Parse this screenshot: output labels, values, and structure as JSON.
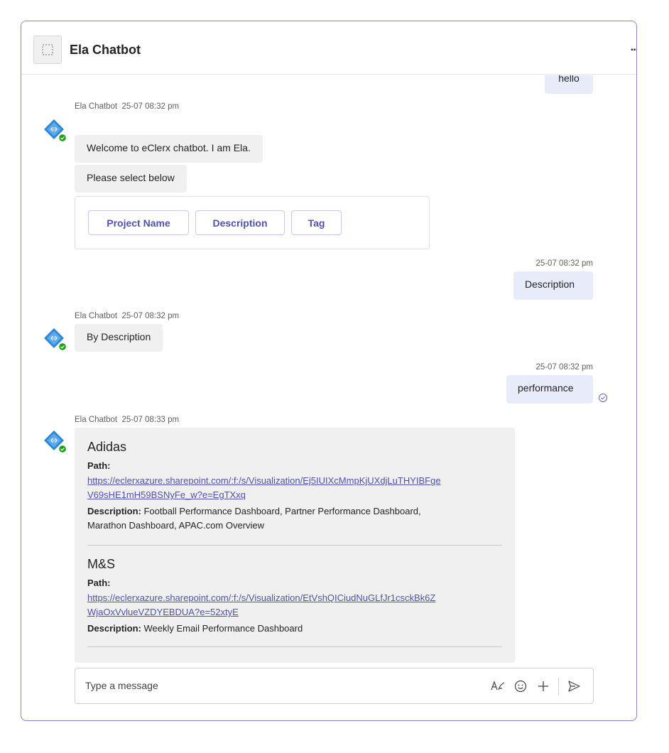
{
  "header": {
    "title": "Ela Chatbot",
    "more": "..."
  },
  "messages": {
    "user_hello": "hello",
    "bot1": {
      "sender": "Ela Chatbot",
      "time": "25-07 08:32 pm",
      "welcome": "Welcome to eClerx chatbot. I am Ela.",
      "prompt": "Please select below",
      "options": [
        "Project Name",
        "Description",
        "Tag"
      ]
    },
    "user1": {
      "time": "25-07 08:32 pm",
      "text": "Description"
    },
    "bot2": {
      "sender": "Ela Chatbot",
      "time": "25-07 08:32 pm",
      "text": "By Description"
    },
    "user2": {
      "time": "25-07 08:32 pm",
      "text": "performance"
    },
    "bot3": {
      "sender": "Ela Chatbot",
      "time": "25-07 08:33 pm",
      "results": [
        {
          "title": "Adidas",
          "path_label": "Path:",
          "path_line1": "https://eclerxazure.sharepoint.com/:f:/s/Visualization/Ej5IUIXcMmpKjUXdjLuTHYIBFge",
          "path_line2": "V69sHE1mH59BSNyFe_w?e=EgTXxq",
          "desc_label": "Description:",
          "desc_line1": " Football Performance Dashboard, Partner Performance Dashboard,",
          "desc_line2": "Marathon Dashboard, APAC.com Overview"
        },
        {
          "title": "M&S",
          "path_label": "Path:",
          "path_line1": "https://eclerxazure.sharepoint.com/:f:/s/Visualization/EtVshQICiudNuGLfJr1csckBk6Z",
          "path_line2": "WjaOxVvlueVZDYEBDUA?e=52xtyE",
          "desc_label": "Description:",
          "desc_line1": " Weekly Email Performance Dashboard"
        }
      ]
    }
  },
  "composer": {
    "placeholder": "Type a message"
  },
  "colors": {
    "accent": "#4f52b2",
    "user_bubble": "#e8ebfa",
    "bot_bubble": "#f0f0f0",
    "frame_border": "#8a80d6",
    "bot_avatar": "#2b88d8",
    "status_online": "#13a10e"
  }
}
